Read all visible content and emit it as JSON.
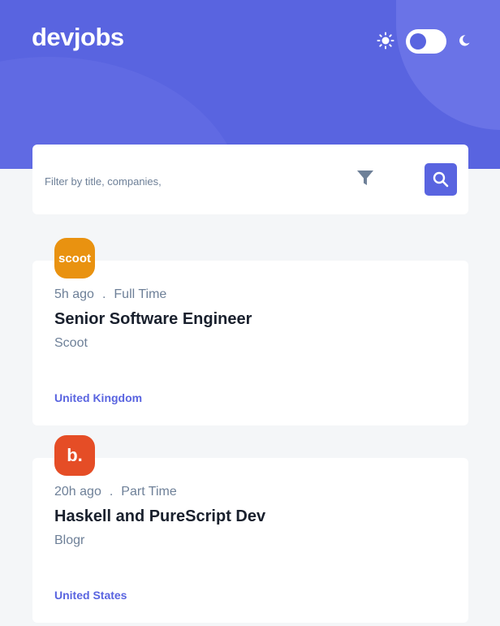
{
  "header": {
    "logo": "devjobs",
    "accent_color": "#5964E0",
    "theme_toggle": {
      "state": "light",
      "sun_icon": "sun-icon",
      "moon_icon": "moon-icon"
    }
  },
  "search": {
    "placeholder": "Filter by title, companies,",
    "filter_icon": "filter-icon",
    "search_icon": "search-icon"
  },
  "jobs": [
    {
      "logo_text": "scoot",
      "logo_color": "#E99210",
      "posted": "5h ago",
      "separator": ".",
      "contract": "Full Time",
      "position": "Senior Software Engineer",
      "company": "Scoot",
      "location": "United Kingdom"
    },
    {
      "logo_text": "b.",
      "logo_color": "#E54D26",
      "posted": "20h ago",
      "separator": ".",
      "contract": "Part Time",
      "position": "Haskell and PureScript Dev",
      "company": "Blogr",
      "location": "United States"
    }
  ]
}
